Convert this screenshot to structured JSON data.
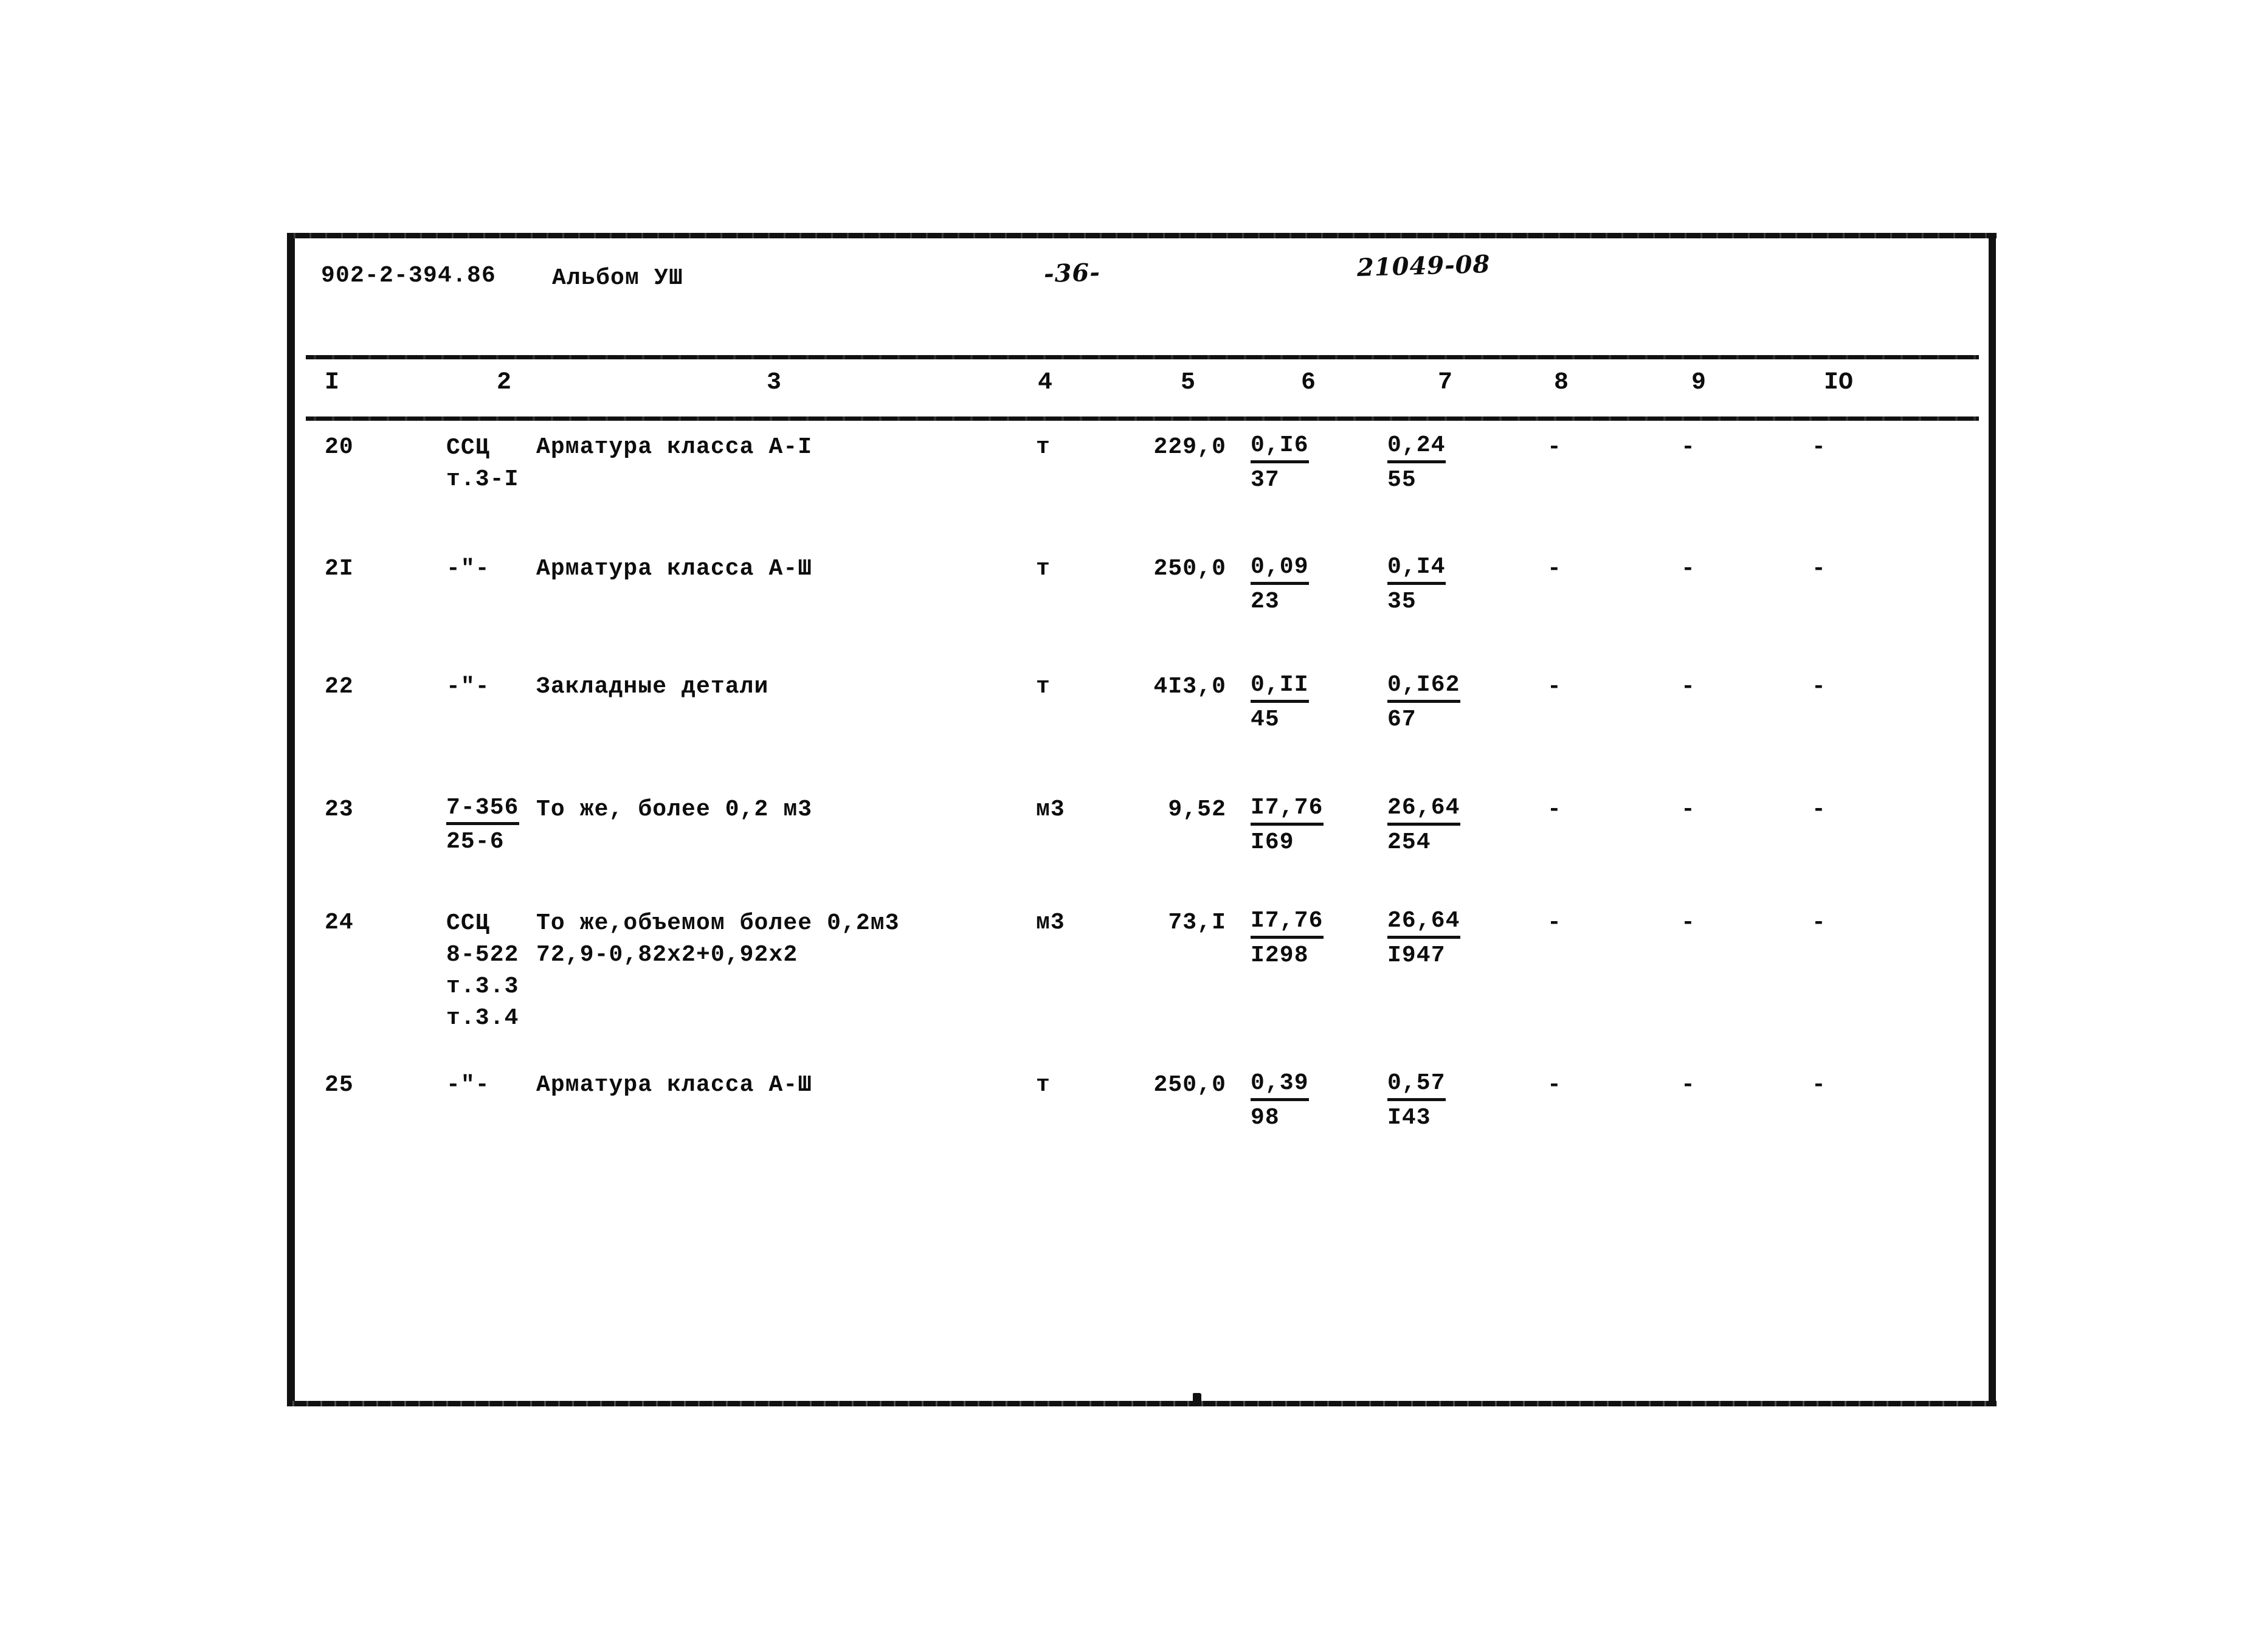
{
  "header": {
    "series_code": "902-2-394.86",
    "album": "Альбом УШ",
    "page_number": "-36-",
    "drawing_number": "21049-08"
  },
  "table": {
    "column_headers": [
      "I",
      "2",
      "3",
      "4",
      "5",
      "6",
      "7",
      "8",
      "9",
      "IO"
    ],
    "rows": [
      {
        "num": "20",
        "code_line1": "ССЦ",
        "code_line2": "т.3-I",
        "desc_line1": "Арматура класса А-I",
        "desc_line2": "",
        "unit": "т",
        "qty": "229,0",
        "col6_num": "0,I6",
        "col6_den": "37",
        "col7_num": "0,24",
        "col7_den": "55",
        "col8": "-",
        "col9": "-",
        "col10": "-"
      },
      {
        "num": "2I",
        "code_line1": "-\"-",
        "code_line2": "",
        "desc_line1": "Арматура класса А-Ш",
        "desc_line2": "",
        "unit": "т",
        "qty": "250,0",
        "col6_num": "0,09",
        "col6_den": "23",
        "col7_num": "0,I4",
        "col7_den": "35",
        "col8": "-",
        "col9": "-",
        "col10": "-"
      },
      {
        "num": "22",
        "code_line1": "-\"-",
        "code_line2": "",
        "desc_line1": "Закладные детали",
        "desc_line2": "",
        "unit": "т",
        "qty": "4I3,0",
        "col6_num": "0,II",
        "col6_den": "45",
        "col7_num": "0,I62",
        "col7_den": "67",
        "col8": "-",
        "col9": "-",
        "col10": "-"
      },
      {
        "num": "23",
        "code_line1": "7-356",
        "code_line2": "25-6",
        "code_underlined": true,
        "desc_line1": "То же, более 0,2 м3",
        "desc_line2": "",
        "unit": "м3",
        "qty": "9,52",
        "col6_num": "I7,76",
        "col6_den": "I69",
        "col7_num": "26,64",
        "col7_den": "254",
        "col8": "-",
        "col9": "-",
        "col10": "-"
      },
      {
        "num": "24",
        "code_line1": "ССЦ",
        "code_line2": "8-522",
        "code_line3": "т.3.3",
        "code_line4": "т.3.4",
        "desc_line1": "То же,объемом более 0,2м3",
        "desc_line2": "72,9-0,82х2+0,92х2",
        "unit": "м3",
        "qty": "73,I",
        "col6_num": "I7,76",
        "col6_den": "I298",
        "col7_num": "26,64",
        "col7_den": "I947",
        "col8": "-",
        "col9": "-",
        "col10": "-"
      },
      {
        "num": "25",
        "code_line1": "-\"-",
        "code_line2": "",
        "desc_line1": "Арматура класса А-Ш",
        "desc_line2": "",
        "unit": "т",
        "qty": "250,0",
        "col6_num": "0,39",
        "col6_den": "98",
        "col7_num": "0,57",
        "col7_den": "I43",
        "col8": "-",
        "col9": "-",
        "col10": "-"
      }
    ]
  }
}
